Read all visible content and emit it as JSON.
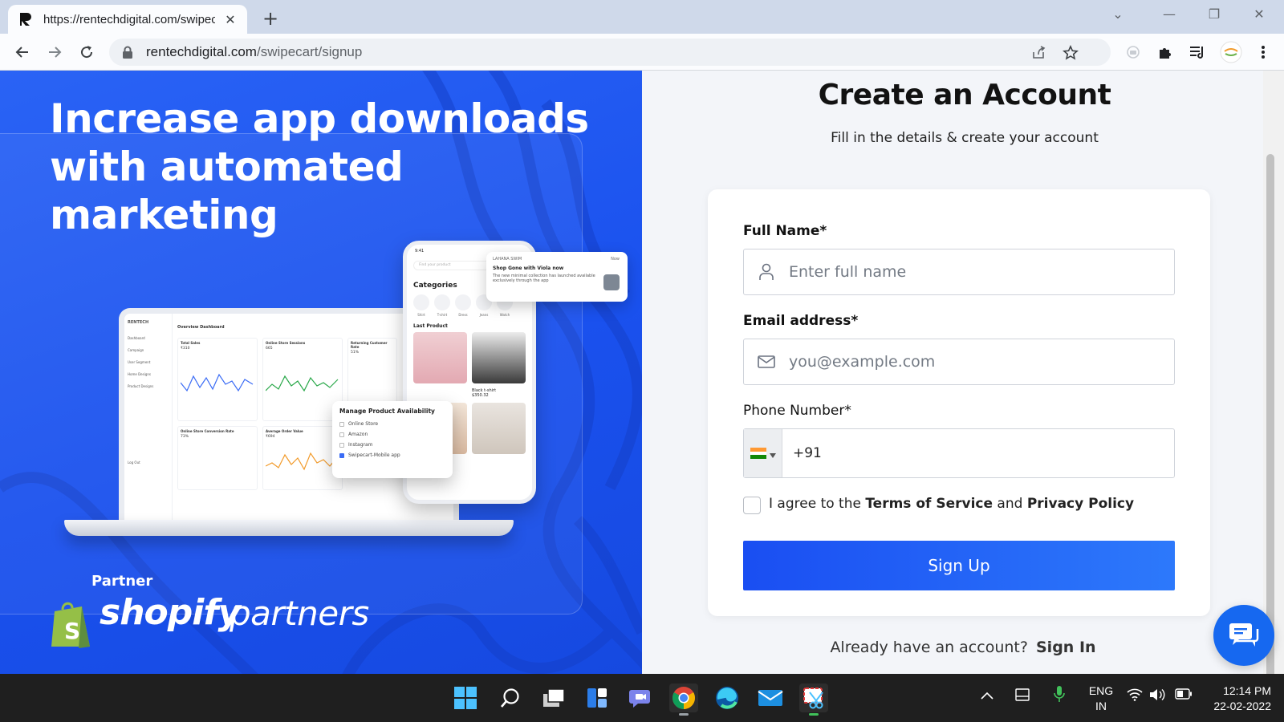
{
  "browser": {
    "tab_title": "https://rentechdigital.com/swipecart/signup",
    "tab_close": "✕",
    "new_tab": "+",
    "url_host": "rentechdigital.com",
    "url_path": "/swipecart/signup",
    "window_controls": {
      "dropdown": "⌄",
      "minimize": "—",
      "restore": "❐",
      "close": "✕"
    }
  },
  "hero": {
    "headline": "Increase app downloads with automated marketing",
    "partner_label": "Partner",
    "shopify_word": "shopify",
    "partners_word": "partners",
    "mockup": {
      "brand": "RENTECH",
      "sidebar": [
        "Dashboard",
        "Campaign",
        "User Segment",
        "Home Designs",
        "Product Designs",
        "Log Out"
      ],
      "dashboard_title": "Overview Dashboard",
      "tiles": [
        {
          "title": "Total Sales",
          "value": "₹310"
        },
        {
          "title": "Online Store Sessions",
          "value": "665"
        },
        {
          "title": "Returning Customer Rate",
          "value": "51%"
        },
        {
          "title": "Online Store Conversion Rate",
          "value": "73%"
        },
        {
          "title": "Average Order Value",
          "value": "₹694"
        }
      ],
      "availability_title": "Manage Product Availability",
      "availability_items": [
        {
          "label": "Online Store",
          "checked": false
        },
        {
          "label": "Amazon",
          "checked": false
        },
        {
          "label": "Instagram",
          "checked": false
        },
        {
          "label": "Swipecart-Mobile app",
          "checked": true
        }
      ],
      "phone_time": "9:41",
      "phone_search": "Find your product",
      "categories_label": "Categories",
      "category_names": [
        "Shirt",
        "T-shirt",
        "Dress",
        "Jeans",
        "Watch"
      ],
      "last_product_label": "Last Product",
      "product_name": "Black t-shirt",
      "product_price": "$350.32",
      "notification": {
        "brand": "LAHANA SWIM",
        "time": "Now",
        "title": "Shop Gone with Viola now",
        "body": "The new minimal collection has launched available exclusively through the app"
      }
    }
  },
  "form": {
    "title": "Create an Account",
    "subtitle": "Fill in the details & create your account",
    "full_name_label": "Full Name*",
    "full_name_placeholder": "Enter full name",
    "email_label": "Email address*",
    "email_placeholder": "you@example.com",
    "phone_label": "Phone Number*",
    "phone_code": "+91",
    "agree_prefix": "I agree to the",
    "terms": "Terms of Service",
    "agree_and": "and",
    "privacy": "Privacy Policy",
    "signup_button": "Sign Up",
    "already_text": "Already have an account?",
    "signin_link": "Sign In"
  },
  "taskbar": {
    "lang_top": "ENG",
    "lang_bottom": "IN",
    "time": "12:14 PM",
    "date": "22-02-2022"
  },
  "colors": {
    "hero_blue": "#1a51ee",
    "button_start": "#1a4ef2",
    "button_end": "#2d79fb",
    "chat_blue": "#1668f0",
    "shopify_green": "#95bf47"
  }
}
